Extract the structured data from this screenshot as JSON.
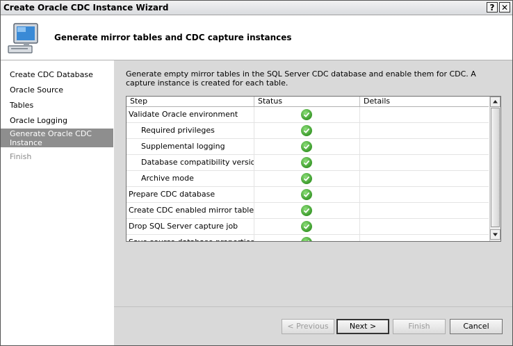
{
  "window": {
    "title": "Create Oracle CDC Instance Wizard",
    "help_glyph": "?",
    "close_glyph": "✕"
  },
  "header": {
    "title": "Generate mirror tables and CDC capture instances",
    "icon": "computer-monitor-icon"
  },
  "sidebar": {
    "items": [
      {
        "label": "Create CDC Database",
        "state": "normal"
      },
      {
        "label": "Oracle Source",
        "state": "normal"
      },
      {
        "label": "Tables",
        "state": "normal"
      },
      {
        "label": "Oracle Logging",
        "state": "normal"
      },
      {
        "label": "Generate Oracle CDC Instance",
        "line1": "Generate Oracle CDC",
        "line2": "Instance",
        "state": "active"
      },
      {
        "label": "Finish",
        "state": "disabled"
      }
    ]
  },
  "main": {
    "description": "Generate empty mirror tables in the SQL Server CDC database and enable them for CDC.  A capture instance is created for each table.",
    "grid": {
      "columns": [
        "Step",
        "Status",
        "Details"
      ],
      "rows": [
        {
          "step": "Validate Oracle environment",
          "indent": false,
          "status": "success",
          "details": ""
        },
        {
          "step": "Required privileges",
          "indent": true,
          "status": "success",
          "details": ""
        },
        {
          "step": "Supplemental logging",
          "indent": true,
          "status": "success",
          "details": ""
        },
        {
          "step": "Database compatibility version",
          "indent": true,
          "status": "success",
          "details": ""
        },
        {
          "step": "Archive mode",
          "indent": true,
          "status": "success",
          "details": ""
        },
        {
          "step": "Prepare CDC database",
          "indent": false,
          "status": "success",
          "details": ""
        },
        {
          "step": "Create CDC enabled mirror tables",
          "indent": false,
          "status": "success",
          "details": ""
        },
        {
          "step": "Drop SQL Server capture job",
          "indent": false,
          "status": "success",
          "details": ""
        },
        {
          "step": "Save source database properties",
          "indent": false,
          "status": "success",
          "details": ""
        }
      ]
    }
  },
  "footer": {
    "previous_label": "< Previous",
    "next_label": "Next >",
    "finish_label": "Finish",
    "cancel_label": "Cancel"
  },
  "colors": {
    "success": "#3b9a2b",
    "active_nav_bg": "#8e8e8e",
    "panel_bg": "#d9d9d9"
  }
}
